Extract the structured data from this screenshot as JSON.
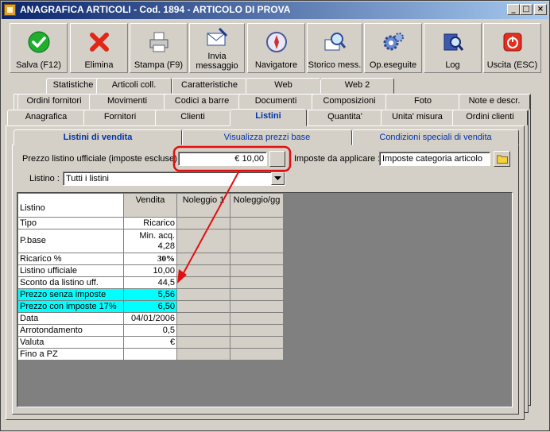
{
  "window": {
    "title": "ANAGRAFICA ARTICOLI - Cod. 1894 - ARTICOLO DI PROVA",
    "minimize": "_",
    "maximize": "□",
    "close": "×"
  },
  "toolbar": [
    {
      "key": "salva",
      "label": "Salva (F12)",
      "icon": "check-icon"
    },
    {
      "key": "elimina",
      "label": "Elimina",
      "icon": "red-x-icon"
    },
    {
      "key": "stampa",
      "label": "Stampa (F9)",
      "icon": "printer-icon"
    },
    {
      "key": "invia",
      "label": "Invia messaggio",
      "icon": "envelope-pen-icon"
    },
    {
      "key": "navigatore",
      "label": "Navigatore",
      "icon": "compass-icon"
    },
    {
      "key": "storico",
      "label": "Storico mess.",
      "icon": "magnifier-mail-icon"
    },
    {
      "key": "opeseguite",
      "label": "Op.eseguite",
      "icon": "gears-icon"
    },
    {
      "key": "log",
      "label": "Log",
      "icon": "book-magnifier-icon"
    },
    {
      "key": "uscita",
      "label": "Uscita (ESC)",
      "icon": "power-icon"
    }
  ],
  "tabs_row1": [
    "Statistiche",
    "Articoli coll.",
    "Caratteristiche",
    "Web",
    "Web 2"
  ],
  "tabs_row2": [
    "Ordini fornitori",
    "Movimenti",
    "Codici a barre",
    "Documenti",
    "Composizioni",
    "Foto",
    "Note e descr."
  ],
  "tabs_row3": [
    "Anagrafica",
    "Fornitori",
    "Clienti",
    "Listini",
    "Quantita'",
    "Unita' misura",
    "Ordini clienti"
  ],
  "active_tab": "Listini",
  "subtabs": [
    "Listini di vendita",
    "Visualizza prezzi base",
    "Condizioni speciali di vendita"
  ],
  "form": {
    "prezzo_label": "Prezzo listino ufficiale (imposte escluse) :",
    "prezzo_value": "€ 10,00",
    "imposte_label": "Imposte da applicare :",
    "imposte_value": "Imposte categoria articolo",
    "listino_label": "Listino :",
    "listino_value": "Tutti i listini"
  },
  "grid": {
    "headers": [
      "Listino",
      "Vendita",
      "Noleggio 1",
      "Noleggio/gg"
    ],
    "rows": [
      {
        "label": "Tipo",
        "value": "Ricarico"
      },
      {
        "label": "P.base",
        "value": "Min. acq.",
        "value2": "4,28"
      },
      {
        "label": "Ricarico %",
        "value": "30%"
      },
      {
        "label": "Listino ufficiale",
        "value": "10,00"
      },
      {
        "label": "Sconto da listino uff.",
        "value": "44,5"
      },
      {
        "label": "Prezzo senza imposte",
        "value": "5,56"
      },
      {
        "label": "Prezzo con imposte 17%",
        "value": "6,50"
      },
      {
        "label": "Data",
        "value": "04/01/2006"
      },
      {
        "label": "Arrotondamento",
        "value": "0,5"
      },
      {
        "label": "Valuta",
        "value": "€"
      },
      {
        "label": "Fino a PZ",
        "value": ""
      }
    ]
  },
  "colors": {
    "highlight_cyan": "#00ffff",
    "annotation_red": "#e01010",
    "title_blue": "#0a246a"
  }
}
